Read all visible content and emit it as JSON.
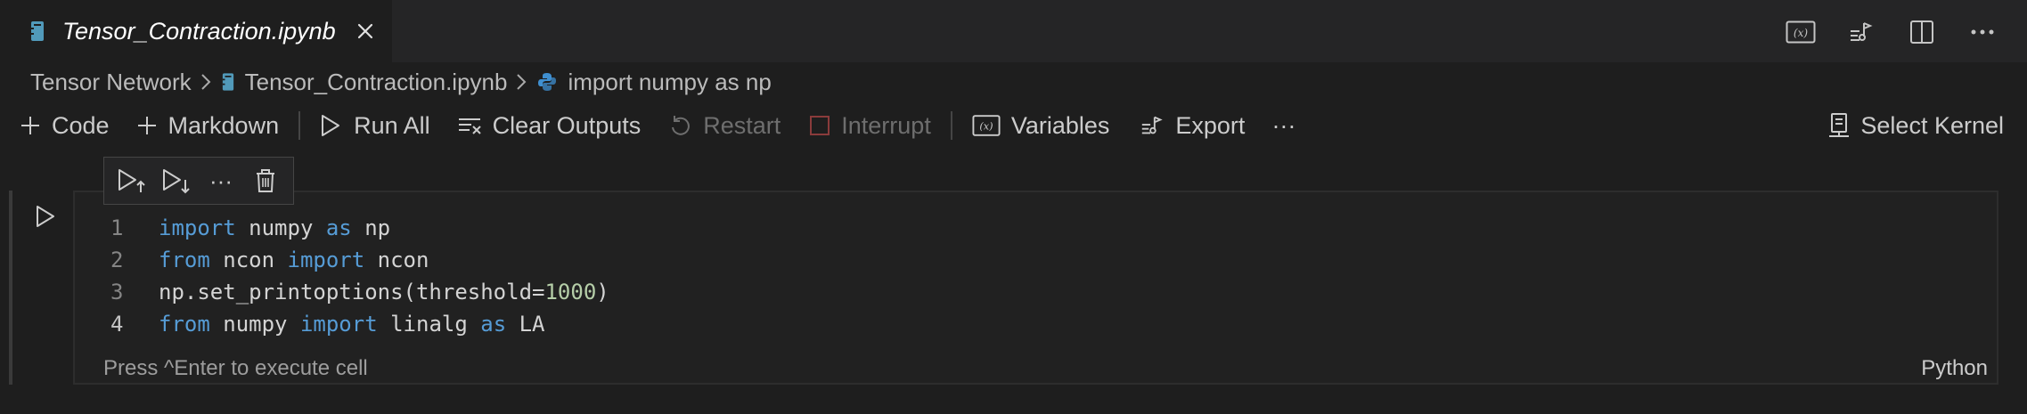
{
  "tab": {
    "title": "Tensor_Contraction.ipynb",
    "icon": "notebook-icon",
    "close_icon": "close-icon"
  },
  "title_actions": [
    "variables-icon",
    "outline-icon",
    "split-editor-icon",
    "more-actions-icon"
  ],
  "breadcrumb": {
    "items": [
      {
        "label": "Tensor Network",
        "icon": null
      },
      {
        "label": "Tensor_Contraction.ipynb",
        "icon": "notebook-icon"
      },
      {
        "label": "import numpy as np",
        "icon": "python-icon"
      }
    ]
  },
  "toolbar": {
    "code_label": "Code",
    "markdown_label": "Markdown",
    "run_all_label": "Run All",
    "clear_outputs_label": "Clear Outputs",
    "restart_label": "Restart",
    "interrupt_label": "Interrupt",
    "variables_label": "Variables",
    "export_label": "Export",
    "more_label": "···",
    "select_kernel_label": "Select Kernel"
  },
  "cell": {
    "line_numbers": [
      "1",
      "2",
      "3",
      "4"
    ],
    "lines": [
      [
        {
          "t": "import",
          "k": "kw"
        },
        {
          "t": " numpy ",
          "k": ""
        },
        {
          "t": "as",
          "k": "kw"
        },
        {
          "t": " np",
          "k": ""
        }
      ],
      [
        {
          "t": "from",
          "k": "kw"
        },
        {
          "t": " ncon ",
          "k": ""
        },
        {
          "t": "import",
          "k": "kw"
        },
        {
          "t": " ncon",
          "k": ""
        }
      ],
      [
        {
          "t": "np.set_printoptions(threshold=",
          "k": ""
        },
        {
          "t": "1000",
          "k": "num"
        },
        {
          "t": ")",
          "k": ""
        }
      ],
      [
        {
          "t": "from",
          "k": "kw"
        },
        {
          "t": " numpy ",
          "k": ""
        },
        {
          "t": "import",
          "k": "kw"
        },
        {
          "t": " linalg ",
          "k": ""
        },
        {
          "t": "as",
          "k": "kw"
        },
        {
          "t": " LA",
          "k": ""
        }
      ]
    ],
    "status_hint": "Press ^Enter to execute cell",
    "language": "Python",
    "toolbar_more": "···"
  },
  "colors": {
    "background": "#1e1e1e",
    "keyword": "#569cd6",
    "number": "#b5cea8",
    "text": "#d4d4d4",
    "notebook_icon": "#519aba",
    "python_icon": "#3f8fd0"
  }
}
